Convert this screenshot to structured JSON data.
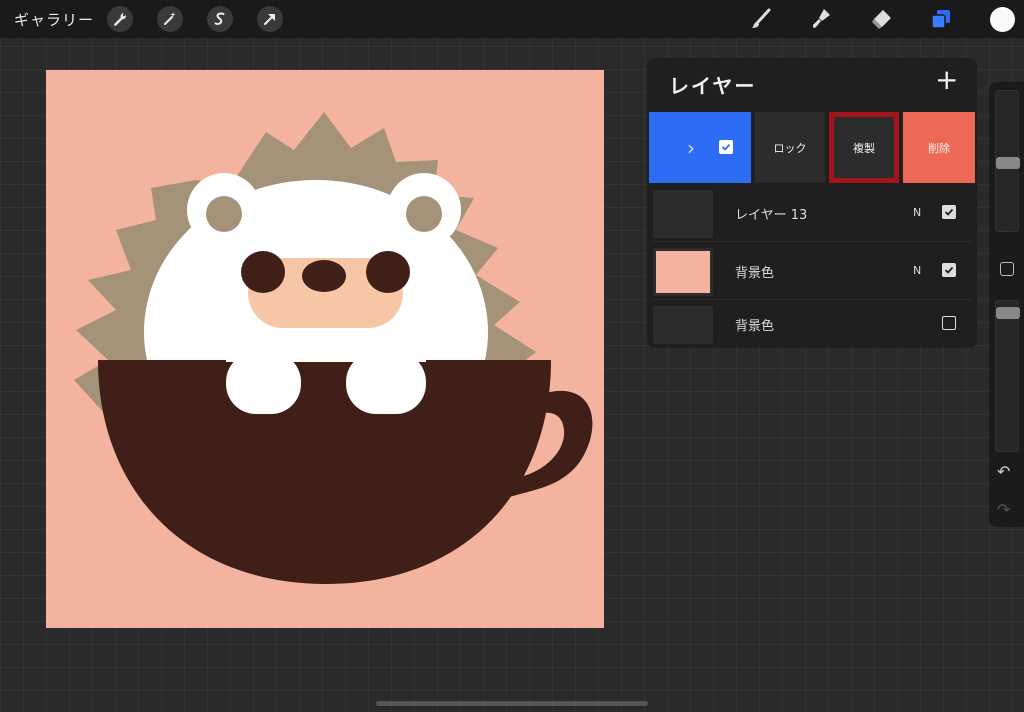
{
  "topbar": {
    "gallery_label": "ギャラリー",
    "left_tools": [
      "wrench-icon",
      "magic-wand-icon",
      "selection-icon",
      "transform-arrow-icon"
    ],
    "right_tools": [
      "brush-icon",
      "smudge-icon",
      "eraser-icon",
      "layers-icon"
    ],
    "current_color": "#fafafa",
    "accent_color": "#2f6cf5"
  },
  "canvas": {
    "background_color": "#f4b39e"
  },
  "layers_panel": {
    "title": "レイヤー",
    "add_symbol": "+",
    "actions": {
      "lock_label": "ロック",
      "duplicate_label": "複製",
      "delete_label": "削除"
    },
    "layers": [
      {
        "name": "レイヤー 13",
        "blend": "N",
        "visible": true
      },
      {
        "name": "背景色",
        "blend": "N",
        "visible": true
      },
      {
        "name": "背景色",
        "blend": "",
        "visible": false
      }
    ]
  },
  "sidebar": {
    "undo_symbol": "↶",
    "redo_symbol": "↷"
  }
}
